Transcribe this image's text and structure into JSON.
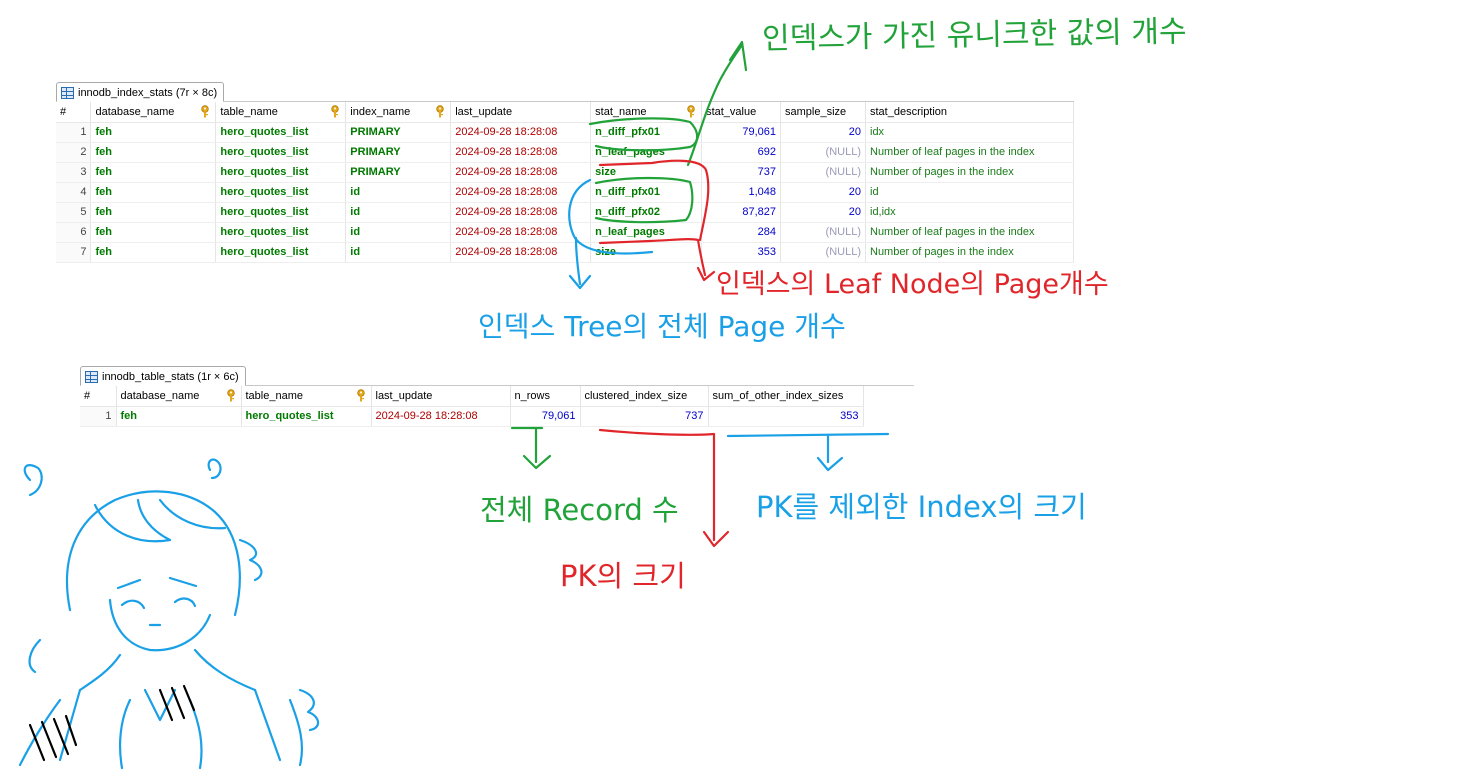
{
  "colors": {
    "green_ink": "#22a33a",
    "red_ink": "#e0262b",
    "blue_ink": "#1aa0e6",
    "text_green": "#007a00",
    "date_red": "#b00000",
    "number_blue": "#0000c8",
    "null_gray": "#9a9ab8"
  },
  "index_stats": {
    "tab_label": "innodb_index_stats (7r × 8c)",
    "columns": [
      "#",
      "database_name",
      "table_name",
      "index_name",
      "last_update",
      "stat_name",
      "stat_value",
      "sample_size",
      "stat_description"
    ],
    "rows": [
      [
        "1",
        "feh",
        "hero_quotes_list",
        "PRIMARY",
        "2024-09-28 18:28:08",
        "n_diff_pfx01",
        "79,061",
        "20",
        "idx"
      ],
      [
        "2",
        "feh",
        "hero_quotes_list",
        "PRIMARY",
        "2024-09-28 18:28:08",
        "n_leaf_pages",
        "692",
        "(NULL)",
        "Number of leaf pages in the index"
      ],
      [
        "3",
        "feh",
        "hero_quotes_list",
        "PRIMARY",
        "2024-09-28 18:28:08",
        "size",
        "737",
        "(NULL)",
        "Number of pages in the index"
      ],
      [
        "4",
        "feh",
        "hero_quotes_list",
        "id",
        "2024-09-28 18:28:08",
        "n_diff_pfx01",
        "1,048",
        "20",
        "id"
      ],
      [
        "5",
        "feh",
        "hero_quotes_list",
        "id",
        "2024-09-28 18:28:08",
        "n_diff_pfx02",
        "87,827",
        "20",
        "id,idx"
      ],
      [
        "6",
        "feh",
        "hero_quotes_list",
        "id",
        "2024-09-28 18:28:08",
        "n_leaf_pages",
        "284",
        "(NULL)",
        "Number of leaf pages in the index"
      ],
      [
        "7",
        "feh",
        "hero_quotes_list",
        "id",
        "2024-09-28 18:28:08",
        "size",
        "353",
        "(NULL)",
        "Number of pages in the index"
      ]
    ]
  },
  "table_stats": {
    "tab_label": "innodb_table_stats (1r × 6c)",
    "columns": [
      "#",
      "database_name",
      "table_name",
      "last_update",
      "n_rows",
      "clustered_index_size",
      "sum_of_other_index_sizes"
    ],
    "rows": [
      [
        "1",
        "feh",
        "hero_quotes_list",
        "2024-09-28 18:28:08",
        "79,061",
        "737",
        "353"
      ]
    ]
  },
  "annotations": {
    "green_top": "인덱스가 가진 유니크한 값의 개수",
    "red_right": "인덱스의 Leaf Node의 Page개수",
    "blue_mid": "인덱스 Tree의 전체 Page 개수",
    "green_bottom": "전체 Record 수",
    "red_bottom": "PK의 크기",
    "blue_bottom": "PK를 제외한 Index의 크기"
  }
}
